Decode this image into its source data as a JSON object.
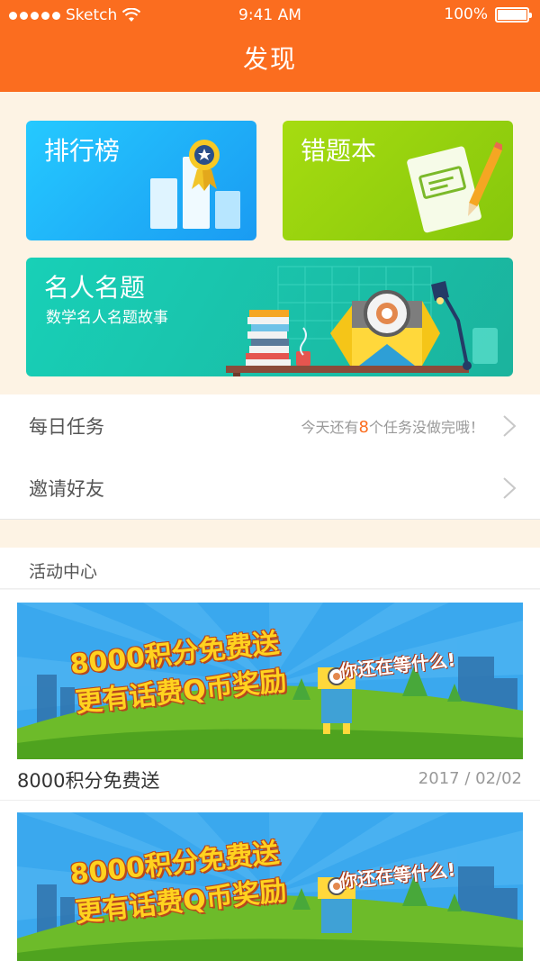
{
  "status": {
    "carrier": "Sketch",
    "time": "9:41 AM",
    "battery": "100%"
  },
  "header": {
    "title": "发现"
  },
  "cards": {
    "rank": {
      "label": "排行榜"
    },
    "wrong": {
      "label": "错题本"
    },
    "famous": {
      "label": "名人名题",
      "sub": "数学名人名题故事"
    }
  },
  "rows": {
    "daily": {
      "label": "每日任务",
      "hint_pre": "今天还有",
      "hint_count": "8",
      "hint_post": "个任务没做完哦！"
    },
    "invite": {
      "label": "邀请好友"
    }
  },
  "activity": {
    "section_title": "活动中心",
    "items": [
      {
        "banner_line1": "8000积分免费送",
        "banner_line2": "更有话费Q币奖励",
        "banner_line3": "你还在等什么!",
        "title": "8000积分免费送",
        "date": "2017 / 02/02"
      },
      {
        "banner_line1": "8000积分免费送",
        "banner_line2": "更有话费Q币奖励",
        "banner_line3": "你还在等什么!"
      }
    ]
  },
  "colors": {
    "brand": "#fb6d1f",
    "card_blue": "#1fb4f8",
    "card_green": "#96d20e",
    "card_teal": "#19c3aa"
  }
}
